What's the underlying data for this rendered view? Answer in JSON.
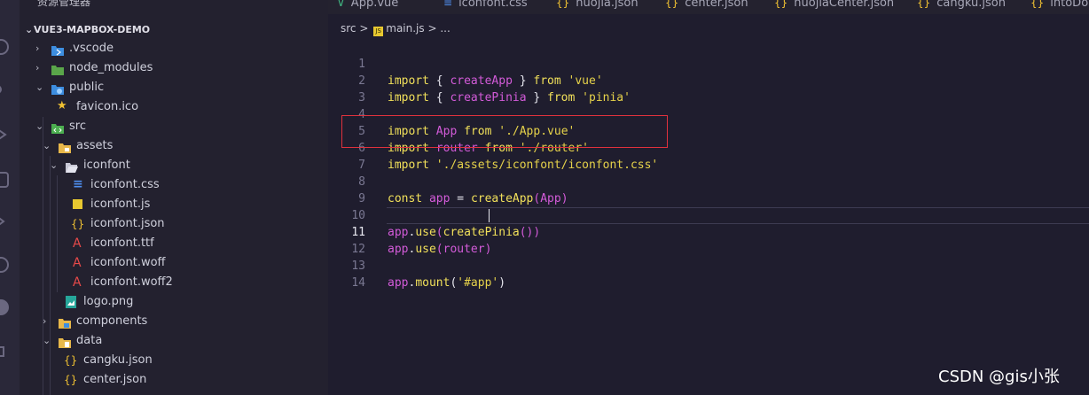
{
  "explorer": {
    "header": "资源管理器",
    "more": "···",
    "project": "VUE3-MAPBOX-DEMO",
    "items": [
      {
        "label": ".vscode",
        "expanded": false,
        "icon": "vscode-folder-icon"
      },
      {
        "label": "node_modules",
        "expanded": false,
        "icon": "node-folder-icon"
      },
      {
        "label": "public",
        "expanded": true,
        "icon": "public-folder-icon"
      },
      {
        "label": "favicon.ico",
        "icon": "star-icon"
      },
      {
        "label": "src",
        "expanded": true,
        "icon": "src-folder-icon"
      },
      {
        "label": "assets",
        "expanded": true,
        "icon": "assets-folder-icon"
      },
      {
        "label": "iconfont",
        "expanded": true,
        "icon": "folder-open-icon"
      },
      {
        "label": "iconfont.css",
        "icon": "css-file-icon"
      },
      {
        "label": "iconfont.js",
        "icon": "js-file-icon"
      },
      {
        "label": "iconfont.json",
        "icon": "json-file-icon"
      },
      {
        "label": "iconfont.ttf",
        "icon": "font-file-icon"
      },
      {
        "label": "iconfont.woff",
        "icon": "font-file-icon"
      },
      {
        "label": "iconfont.woff2",
        "icon": "font-file-icon"
      },
      {
        "label": "logo.png",
        "icon": "image-file-icon"
      },
      {
        "label": "components",
        "expanded": false,
        "icon": "components-folder-icon"
      },
      {
        "label": "data",
        "expanded": true,
        "icon": "data-folder-icon"
      },
      {
        "label": "cangku.json",
        "icon": "json-file-icon"
      },
      {
        "label": "center.json",
        "icon": "json-file-icon"
      }
    ]
  },
  "tabs": [
    {
      "label": "App.vue",
      "icon": "vue-icon"
    },
    {
      "label": "iconfont.css",
      "icon": "css-icon"
    },
    {
      "label": "huojia.json",
      "icon": "json-icon"
    },
    {
      "label": "center.json",
      "icon": "json-icon"
    },
    {
      "label": "huojiaCenter.json",
      "icon": "json-icon"
    },
    {
      "label": "cangku.json",
      "icon": "json-icon"
    },
    {
      "label": "intoDo",
      "icon": "json-icon"
    }
  ],
  "breadcrumb": {
    "folder": "src",
    "sep": ">",
    "file": "main.js",
    "tail": "> ..."
  },
  "code": {
    "lines": [
      "1",
      "2",
      "3",
      "4",
      "5",
      "6",
      "7",
      "8",
      "9",
      "10",
      "11",
      "12",
      "13",
      "14"
    ],
    "l1": {
      "kw": "import",
      "a": " { ",
      "fn": "createApp",
      "b": " } ",
      "kw2": "from",
      "sp": " ",
      "str": "'vue'"
    },
    "l2": {
      "kw": "import",
      "a": " { ",
      "fn": "createPinia",
      "b": " } ",
      "kw2": "from",
      "sp": " ",
      "str": "'pinia'"
    },
    "l4": {
      "kw": "import",
      "sp": " ",
      "fn": "App",
      "sp2": " ",
      "kw2": "from",
      "sp3": " ",
      "str": "'./App.vue'"
    },
    "l5": {
      "kw": "import",
      "sp": " ",
      "fn": "router",
      "sp2": " ",
      "kw2": "from",
      "sp3": " ",
      "str": "'./router'"
    },
    "l6": {
      "kw": "import",
      "sp": " ",
      "str": "'./assets/iconfont/iconfont.css'"
    },
    "l8": {
      "kw": "const",
      "sp": " ",
      "fn": "app",
      "eq": " = ",
      "fn2": "createApp",
      "p1": "(",
      "arg": "App",
      "p2": ")"
    },
    "l10": {
      "obj": "app",
      "dot": ".",
      "fn": "use",
      "p1": "(",
      "fn2": "createPinia",
      "p2": "())"
    },
    "l11": {
      "obj": "app",
      "dot": ".",
      "fn": "use",
      "p1": "(",
      "arg": "router",
      "p2": ")"
    },
    "l13": {
      "obj": "app",
      "dot": ".",
      "fn": "mount",
      "p1": "(",
      "str": "'#app'",
      "p2": ")"
    }
  },
  "watermark": "CSDN @gis小张",
  "colors": {
    "keyword": "#f1e05a",
    "function": "#d35bd9",
    "highlight_box": "#e0313d"
  }
}
